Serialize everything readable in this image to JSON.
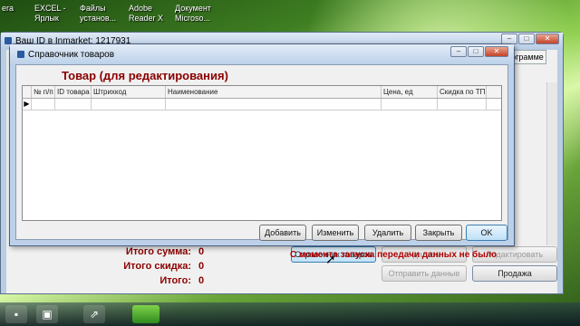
{
  "desktop": {
    "icons": [
      {
        "label_1": "era",
        "label_2": ""
      },
      {
        "label_1": "EXCEL -",
        "label_2": "Ярлык"
      },
      {
        "label_1": "Файлы",
        "label_2": "установ..."
      },
      {
        "label_1": "Adobe",
        "label_2": "Reader X"
      },
      {
        "label_1": "Документ",
        "label_2": "Microso..."
      }
    ]
  },
  "main_window": {
    "title": "Ваш ID в Inmarket: 1217931",
    "tab_label": "программе",
    "totals": [
      {
        "label": "Итого сумма:",
        "value": "0"
      },
      {
        "label": "Итого скидка:",
        "value": "0"
      },
      {
        "label": "Итого:",
        "value": "0"
      }
    ],
    "buttons": {
      "catalog": "Справочник товаров",
      "delete": "Удалить",
      "edit": "Редактировать",
      "send": "Отправить данные",
      "sale": "Продажа"
    },
    "status": "С момента запуска передачи данных не было"
  },
  "dialog": {
    "title": "Справочник товаров",
    "heading": "Товар (для редактирования)",
    "columns": [
      "№ п/п",
      "ID товара",
      "Штрихкод",
      "Наименование",
      "Цена, ед",
      "Скидка по ТП"
    ],
    "row_marker": "▶",
    "buttons": {
      "add": "Добавить",
      "change": "Изменить",
      "delete": "Удалить",
      "close": "Закрыть",
      "ok": "OK"
    }
  },
  "colors": {
    "accent_red": "#8b0000",
    "window_frame": "#bcd1e9"
  }
}
